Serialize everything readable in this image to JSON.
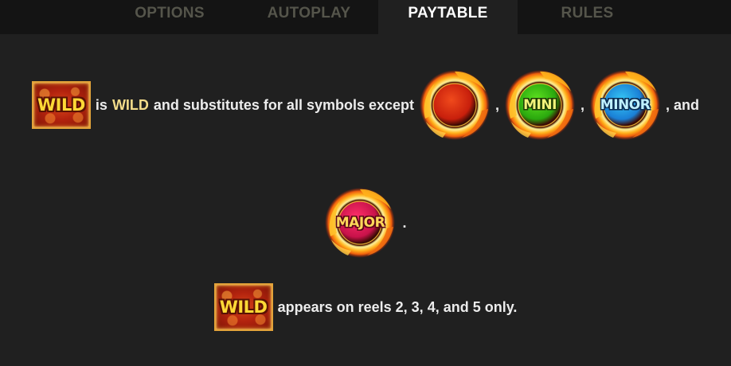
{
  "tabs": [
    {
      "label": "OPTIONS",
      "active": false
    },
    {
      "label": "AUTOPLAY",
      "active": false
    },
    {
      "label": "PAYTABLE",
      "active": true
    },
    {
      "label": "RULES",
      "active": false
    }
  ],
  "colors": {
    "background": "#202020",
    "tabbar": "#141414",
    "tab_inactive_text": "#55554b",
    "tab_active_text": "#ffffff",
    "body_text": "#ececec",
    "highlight_text": "#f3dc8a"
  },
  "wild_symbol": {
    "word": "WILD",
    "icon": "wild-symbol-icon"
  },
  "paytable": {
    "line1": {
      "is_text": "is",
      "wild_highlight": "WILD",
      "substitutes_text": "and substitutes for all symbols except",
      "comma": ",",
      "and_text": ", and"
    },
    "line2": {
      "period": "."
    },
    "line3": {
      "appears_text": "appears on reels 2, 3, 4, and 5 only."
    }
  },
  "jackpot_symbols": [
    {
      "id": "bonus",
      "label": "",
      "icon": "red-fire-orb-icon",
      "core": "#c81f0c",
      "core_light": "#f04a1c"
    },
    {
      "id": "mini",
      "label": "MINI",
      "icon": "green-fire-orb-icon",
      "core": "#2aa80e",
      "core_light": "#5fe320"
    },
    {
      "id": "minor",
      "label": "MINOR",
      "icon": "blue-fire-orb-icon",
      "core": "#1a7fd6",
      "core_light": "#36c8f5"
    },
    {
      "id": "major",
      "label": "MAJOR",
      "icon": "pink-fire-orb-icon",
      "core": "#c8124a",
      "core_light": "#ff2f6a"
    }
  ]
}
